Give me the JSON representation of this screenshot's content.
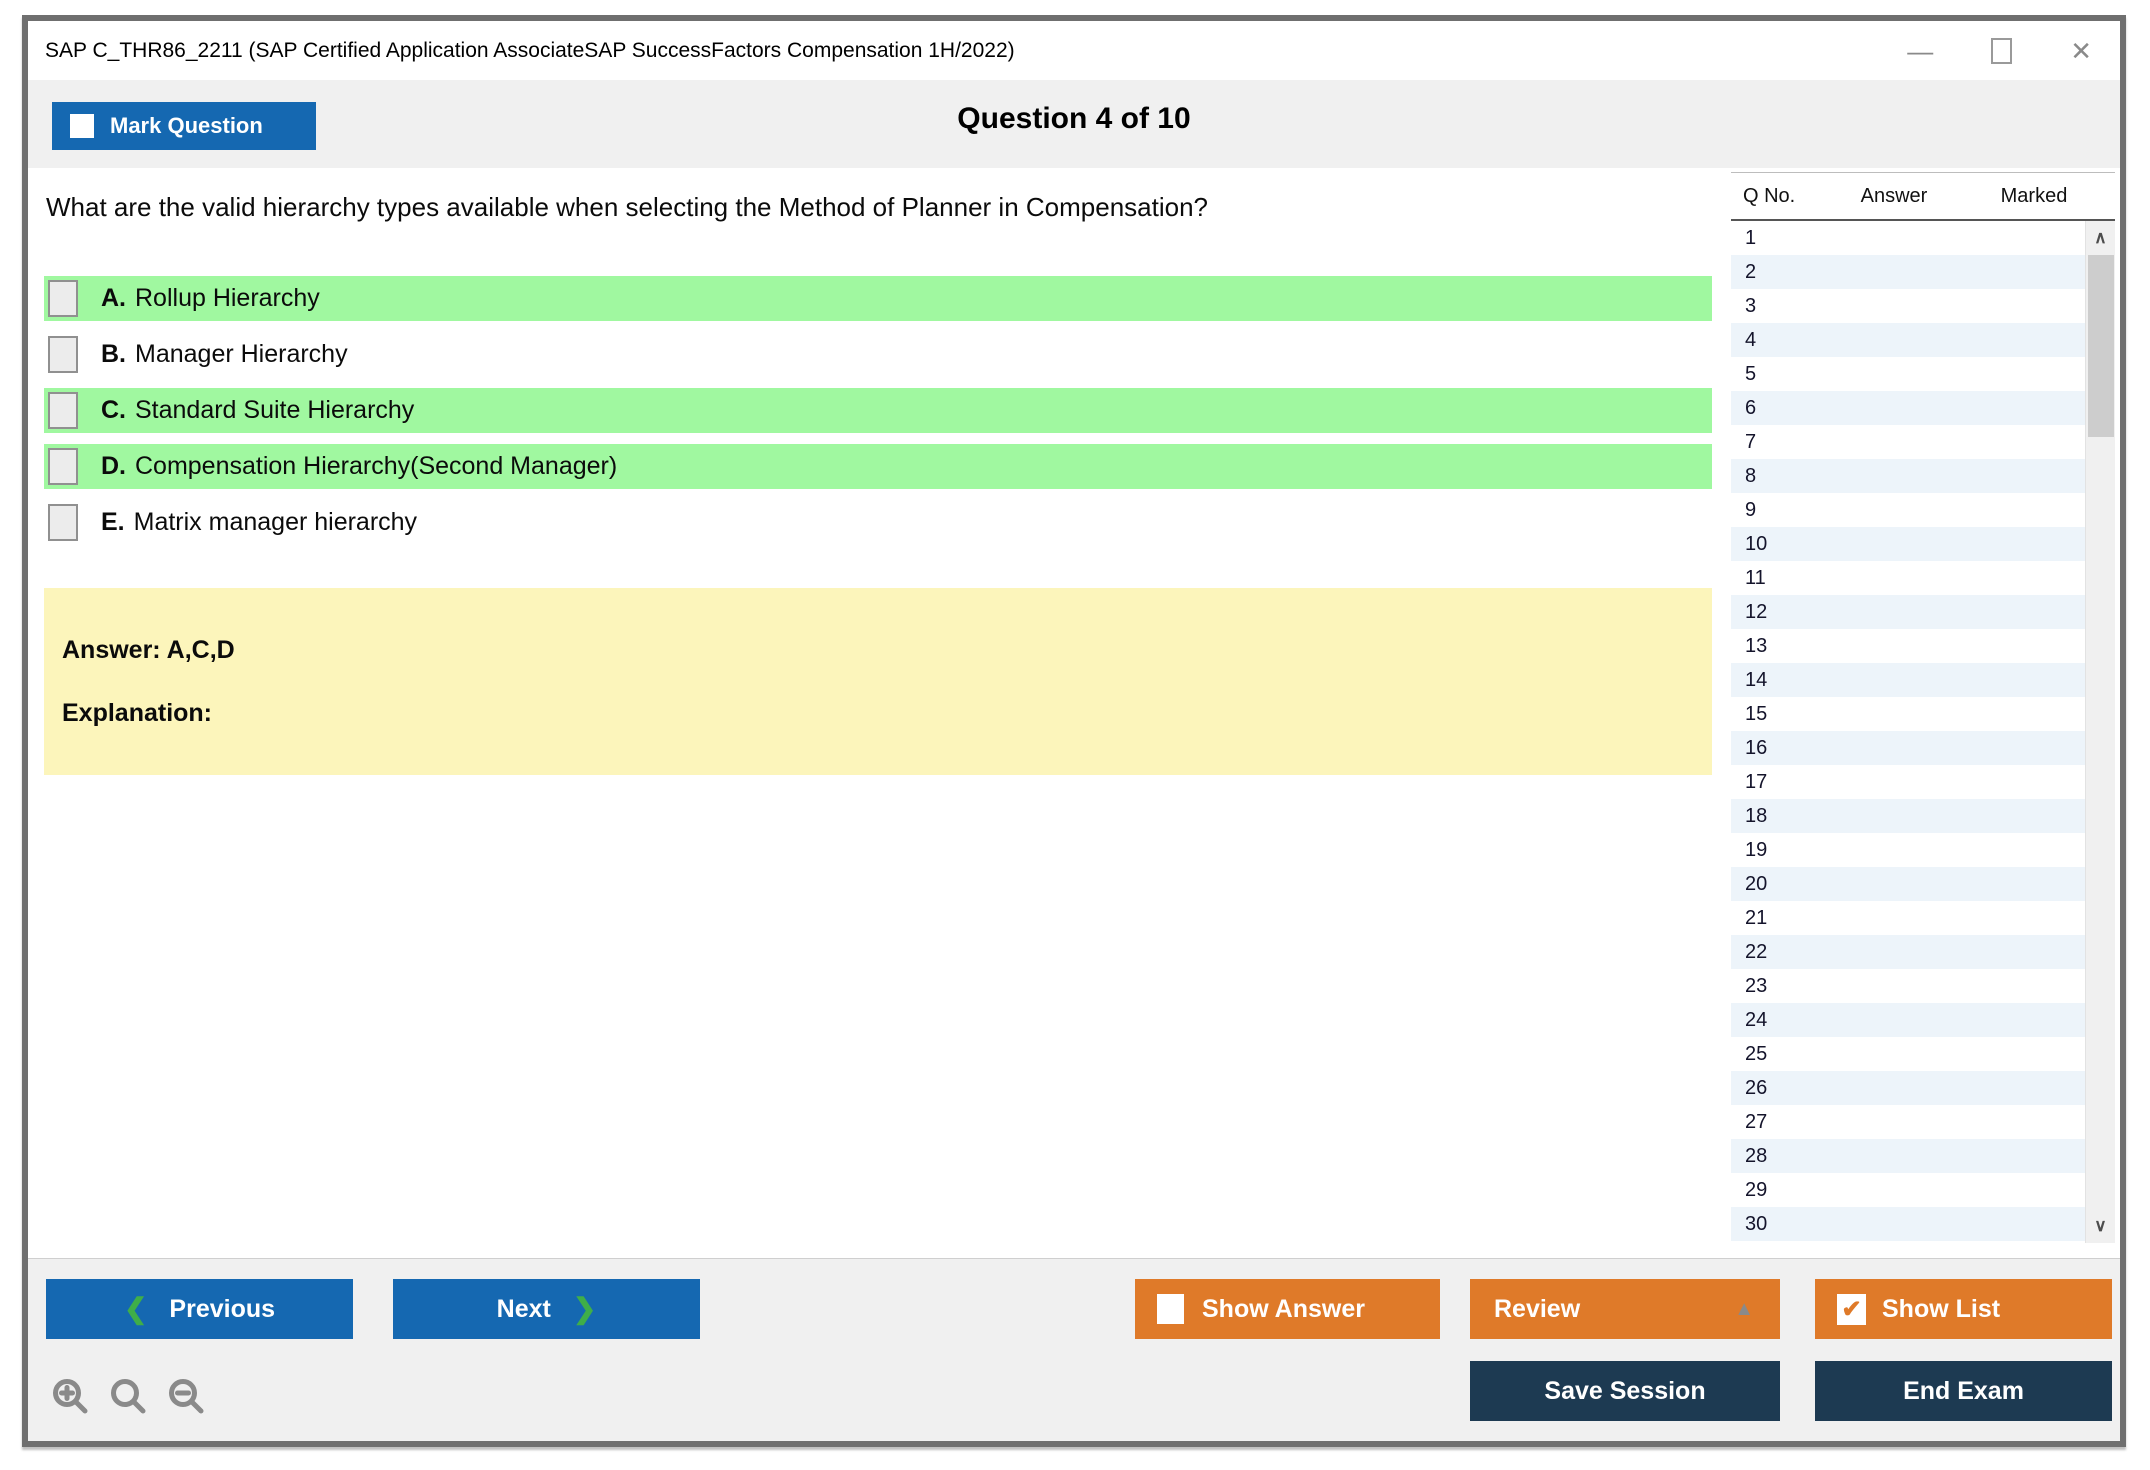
{
  "window": {
    "title": "SAP C_THR86_2211 (SAP Certified Application AssociateSAP SuccessFactors Compensation 1H/2022)",
    "controls": {
      "minimize_glyph": "—",
      "close_glyph": "✕"
    }
  },
  "header": {
    "mark_question_label": "Mark Question",
    "question_counter": "Question 4 of 10"
  },
  "question": {
    "text": "What are the valid hierarchy types available when selecting the Method of Planner in Compensation?",
    "options": [
      {
        "letter": "A.",
        "text": "Rollup Hierarchy",
        "highlighted": true
      },
      {
        "letter": "B.",
        "text": "Manager Hierarchy",
        "highlighted": false
      },
      {
        "letter": "C.",
        "text": "Standard Suite Hierarchy",
        "highlighted": true
      },
      {
        "letter": "D.",
        "text": "Compensation Hierarchy(Second Manager)",
        "highlighted": true
      },
      {
        "letter": "E.",
        "text": "Matrix manager hierarchy",
        "highlighted": false
      }
    ],
    "answer_text": "Answer: A,C,D",
    "explanation_label": "Explanation:"
  },
  "question_list": {
    "columns": [
      "Q No.",
      "Answer",
      "Marked"
    ],
    "rows": [
      "1",
      "2",
      "3",
      "4",
      "5",
      "6",
      "7",
      "8",
      "9",
      "10",
      "11",
      "12",
      "13",
      "14",
      "15",
      "16",
      "17",
      "18",
      "19",
      "20",
      "21",
      "22",
      "23",
      "24",
      "25",
      "26",
      "27",
      "28",
      "29",
      "30"
    ]
  },
  "footer": {
    "previous_label": "Previous",
    "next_label": "Next",
    "show_answer_label": "Show Answer",
    "review_label": "Review",
    "show_list_label": "Show List",
    "save_session_label": "Save Session",
    "end_exam_label": "End Exam"
  },
  "icons": {
    "prev_chevron": "❮",
    "next_chevron": "❯",
    "review_caret": "▲",
    "checked_glyph": "✔",
    "scroll_up": "∧",
    "scroll_down": "∨"
  },
  "colors": {
    "accent_blue": "#1568b1",
    "accent_orange": "#df7a29",
    "dark_navy": "#1d3a52",
    "highlight_green": "#a0f8a0",
    "answer_yellow": "#fcf5bb",
    "row_stripe": "#edf4fa"
  }
}
